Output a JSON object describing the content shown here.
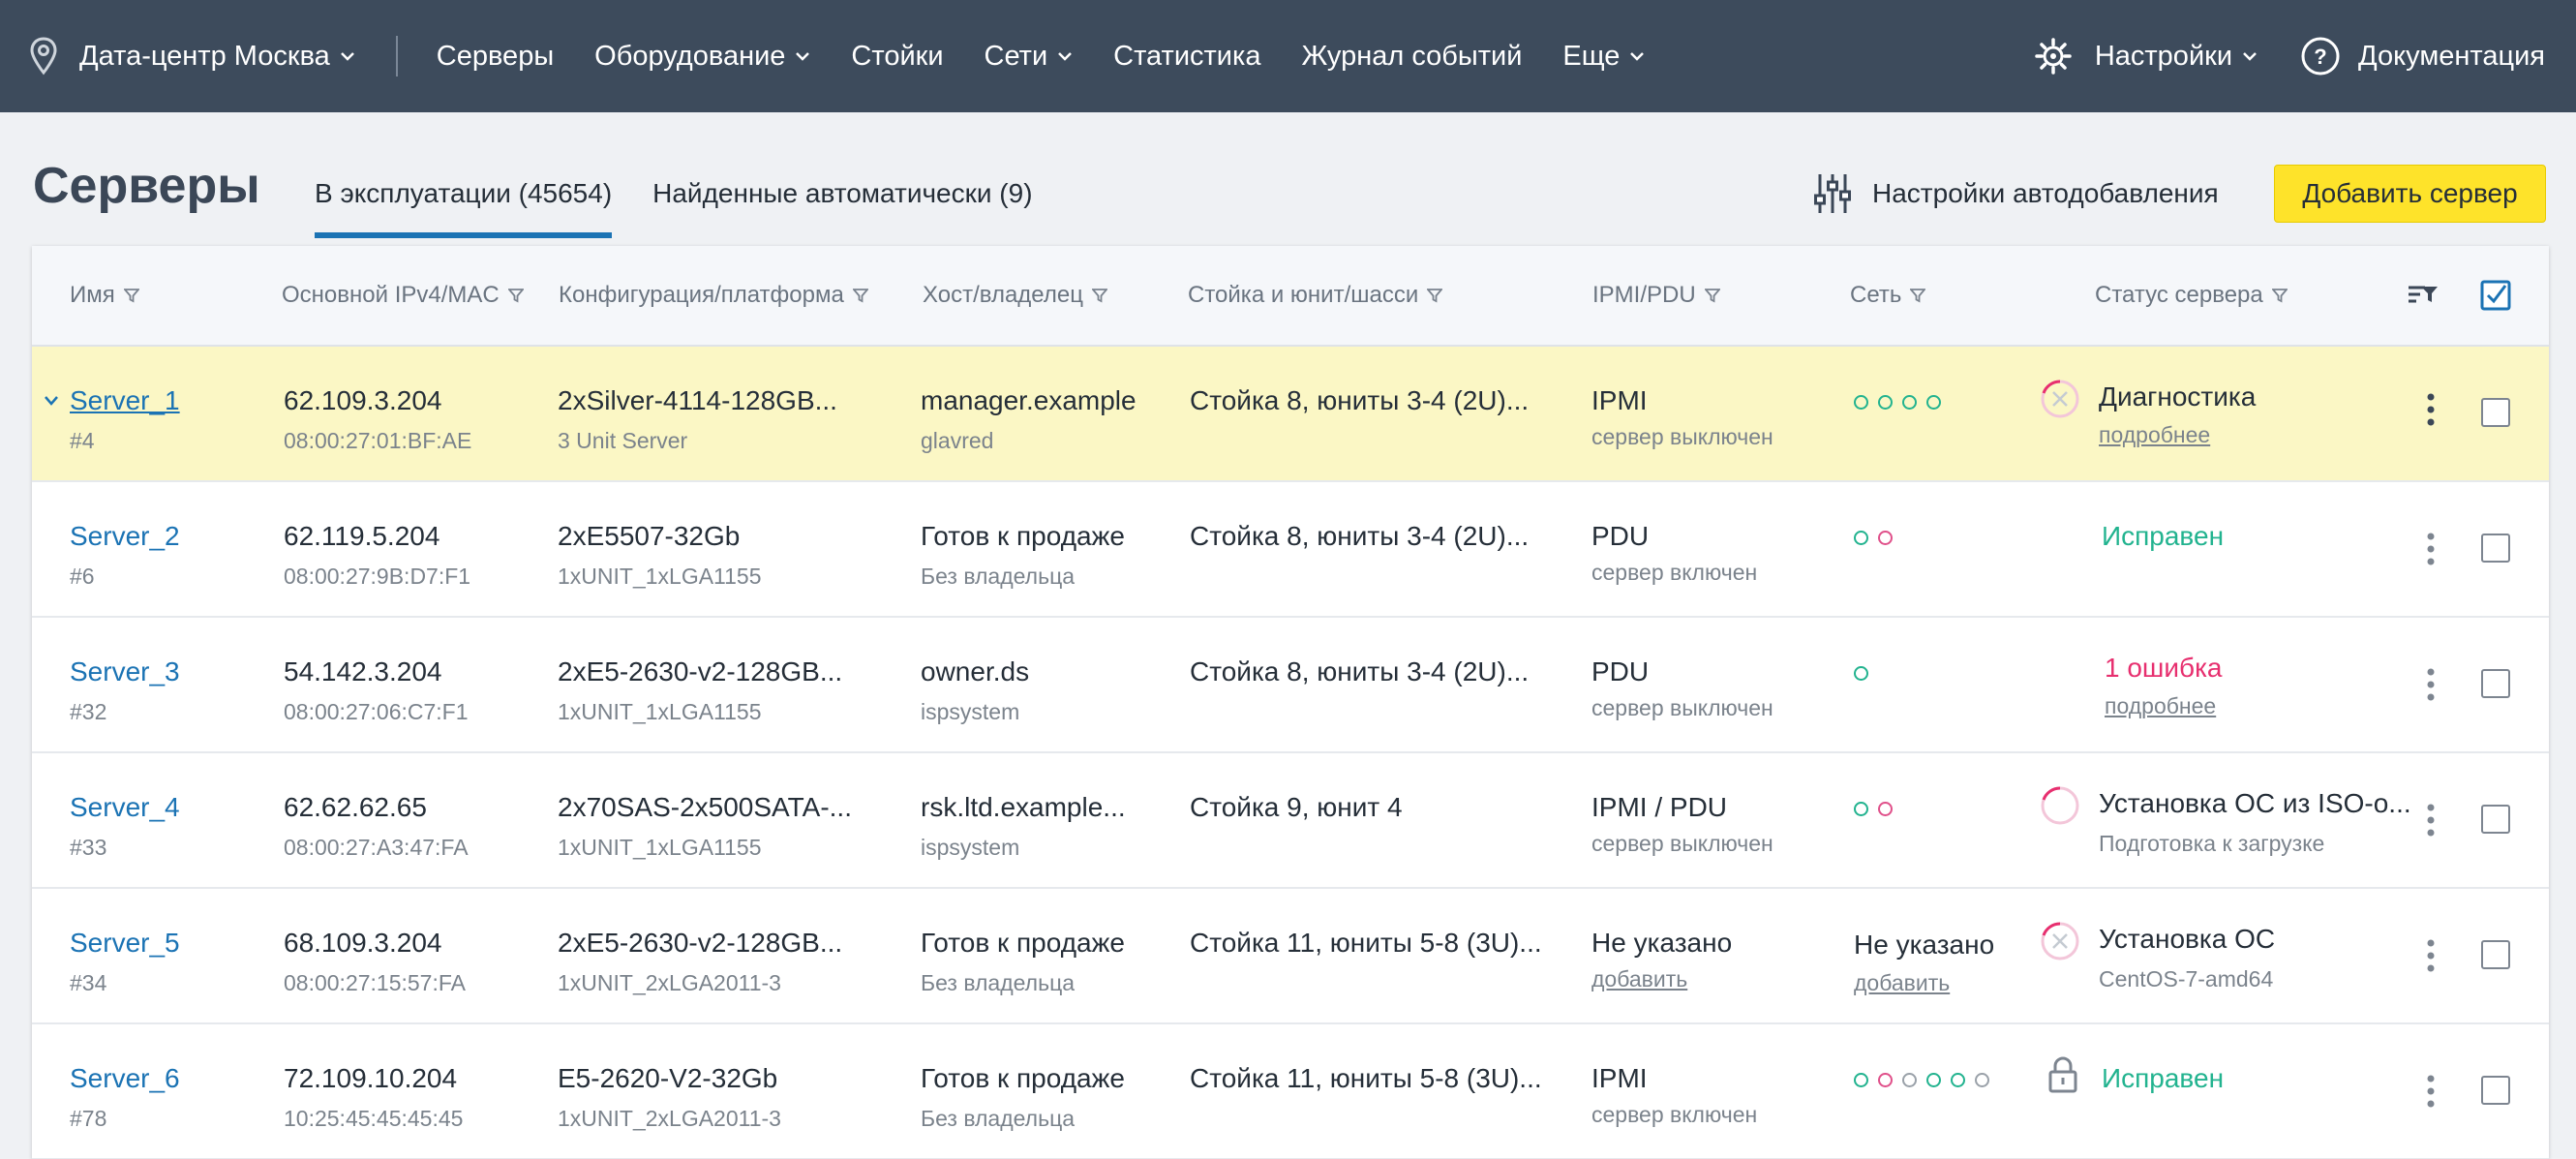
{
  "topbar": {
    "location": "Дата-центр Москва",
    "nav": [
      "Серверы",
      "Оборудование",
      "Стойки",
      "Сети",
      "Статистика",
      "Журнал событий",
      "Еще"
    ],
    "settings": "Настройки",
    "docs": "Документация"
  },
  "page": {
    "title": "Серверы",
    "tabs": [
      "В эксплуатации (45654)",
      "Найденные автоматически (9)"
    ],
    "auto_settings": "Настройки автодобавления",
    "add_button": "Добавить сервер"
  },
  "table": {
    "headers": [
      "Имя",
      "Основной IPv4/MAC",
      "Конфигурация/платформа",
      "Хост/владелец",
      "Стойка и юнит/шасси",
      "IPMI/PDU",
      "Сеть",
      "Статус сервера"
    ],
    "rows": [
      {
        "name": "Server_1",
        "id": "#4",
        "ip": "62.109.3.204",
        "mac": "08:00:27:01:BF:AE",
        "config": "2xSilver-4114-128GB...",
        "platform": "3 Unit Server",
        "host": "manager.example",
        "owner": "glavred",
        "rack": "Стойка 8, юниты 3-4 (2U)...",
        "ipmi": "IPMI",
        "ipmi_sub": "сервер выключен",
        "status": "Диагностика",
        "status_sub": "подробнее"
      },
      {
        "name": "Server_2",
        "id": "#6",
        "ip": "62.119.5.204",
        "mac": "08:00:27:9B:D7:F1",
        "config": "2xE5507-32Gb",
        "platform": "1xUNIT_1xLGA1155",
        "host": "Готов к продаже",
        "owner": "Без владельца",
        "rack": "Стойка 8, юниты 3-4 (2U)...",
        "ipmi": "PDU",
        "ipmi_sub": "сервер включен",
        "status": "Исправен"
      },
      {
        "name": "Server_3",
        "id": "#32",
        "ip": "54.142.3.204",
        "mac": "08:00:27:06:C7:F1",
        "config": "2xE5-2630-v2-128GB...",
        "platform": "1xUNIT_1xLGA1155",
        "host": "owner.ds",
        "owner": "ispsystem",
        "rack": "Стойка 8, юниты 3-4 (2U)...",
        "ipmi": "PDU",
        "ipmi_sub": "сервер выключен",
        "status": "1 ошибка",
        "status_sub": "подробнее"
      },
      {
        "name": "Server_4",
        "id": "#33",
        "ip": "62.62.62.65",
        "mac": "08:00:27:A3:47:FA",
        "config": "2x70SAS-2x500SATA-...",
        "platform": "1xUNIT_1xLGA1155",
        "host": "rsk.ltd.example...",
        "owner": "ispsystem",
        "rack": "Стойка 9, юнит 4",
        "ipmi": "IPMI   / PDU",
        "ipmi_sub": "сервер выключен",
        "status": "Установка ОС из ISO-о...",
        "status_sub": "Подготовка к загрузке"
      },
      {
        "name": "Server_5",
        "id": "#34",
        "ip": "68.109.3.204",
        "mac": "08:00:27:15:57:FA",
        "config": "2xE5-2630-v2-128GB...",
        "platform": "1xUNIT_2xLGA2011-3",
        "host": "Готов к продаже",
        "owner": "Без владельца",
        "rack": "Стойка 11, юниты 5-8 (3U)...",
        "ipmi": "Не указано",
        "ipmi_sub": "добавить",
        "net": "Не указано",
        "net_sub": "добавить",
        "status": "Установка ОС",
        "status_sub": "CentOS-7-amd64"
      },
      {
        "name": "Server_6",
        "id": "#78",
        "ip": "72.109.10.204",
        "mac": "10:25:45:45:45:45",
        "config": "E5-2620-V2-32Gb",
        "platform": "1xUNIT_2xLGA2011-3",
        "host": "Готов к продаже",
        "owner": "Без владельца",
        "rack": "Стойка 11, юниты 5-8 (3U)...",
        "ipmi": "IPMI",
        "ipmi_sub": "сервер включен",
        "status": "Исправен"
      }
    ]
  }
}
